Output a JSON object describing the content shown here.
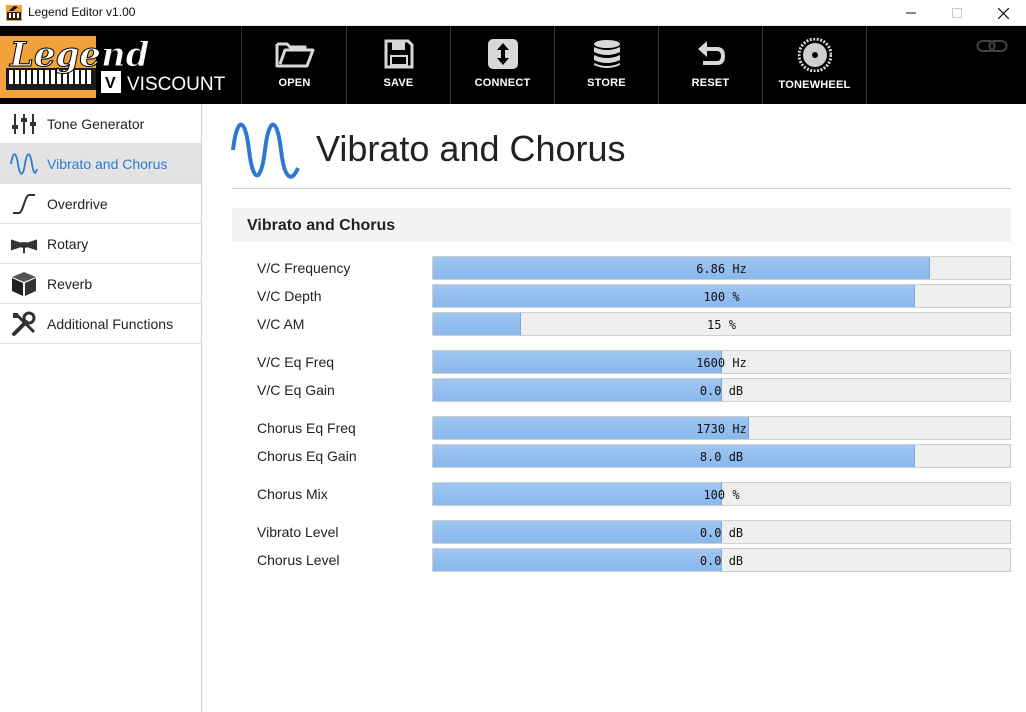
{
  "window": {
    "title": "Legend Editor v1.00"
  },
  "logo": {
    "brand": "Legend",
    "sub": "VISCOUNT",
    "badge": "V"
  },
  "toolbar": {
    "items": [
      {
        "label": "OPEN",
        "icon": "folder-icon"
      },
      {
        "label": "SAVE",
        "icon": "floppy-disk-icon"
      },
      {
        "label": "CONNECT",
        "icon": "up-down-arrows-icon"
      },
      {
        "label": "STORE",
        "icon": "database-icon"
      },
      {
        "label": "RESET",
        "icon": "undo-arrow-icon"
      },
      {
        "label": "TONEWHEEL",
        "icon": "tonewheel-gear-icon"
      }
    ],
    "connection_icon": "link-rings-icon"
  },
  "sidebar": {
    "items": [
      {
        "label": "Tone Generator",
        "icon": "sliders-icon",
        "active": false
      },
      {
        "label": "Vibrato and Chorus",
        "icon": "sine-wave-icon",
        "active": true
      },
      {
        "label": "Overdrive",
        "icon": "overdrive-curve-icon",
        "active": false
      },
      {
        "label": "Rotary",
        "icon": "rotary-horn-icon",
        "active": false
      },
      {
        "label": "Reverb",
        "icon": "cube-icon",
        "active": false
      },
      {
        "label": "Additional Functions",
        "icon": "wrench-screwdriver-icon",
        "active": false
      }
    ]
  },
  "page": {
    "title": "Vibrato and Chorus",
    "icon": "sine-wave-icon",
    "section_title": "Vibrato and Chorus"
  },
  "params": [
    {
      "label": "V/C Frequency",
      "value": "6.86 Hz",
      "fill": 0.862
    },
    {
      "label": "V/C Depth",
      "value": "100 %",
      "fill": 0.835
    },
    {
      "label": "V/C AM",
      "value": "15 %",
      "fill": 0.153
    },
    {
      "label": "V/C Eq Freq",
      "value": "1600 Hz",
      "fill": 0.5
    },
    {
      "label": "V/C Eq Gain",
      "value": "0.0 dB",
      "fill": 0.5
    },
    {
      "label": "Chorus Eq Freq",
      "value": "1730 Hz",
      "fill": 0.548
    },
    {
      "label": "Chorus Eq Gain",
      "value": "8.0 dB",
      "fill": 0.835
    },
    {
      "label": "Chorus Mix",
      "value": "100 %",
      "fill": 0.5
    },
    {
      "label": "Vibrato Level",
      "value": "0.0 dB",
      "fill": 0.5
    },
    {
      "label": "Chorus Level",
      "value": "0.0 dB",
      "fill": 0.5
    }
  ],
  "colors": {
    "accent": "#2c7bd0",
    "slider_fill": "#94bff0",
    "toolbar_bg": "#000000",
    "logo_orange": "#f2a23a"
  }
}
